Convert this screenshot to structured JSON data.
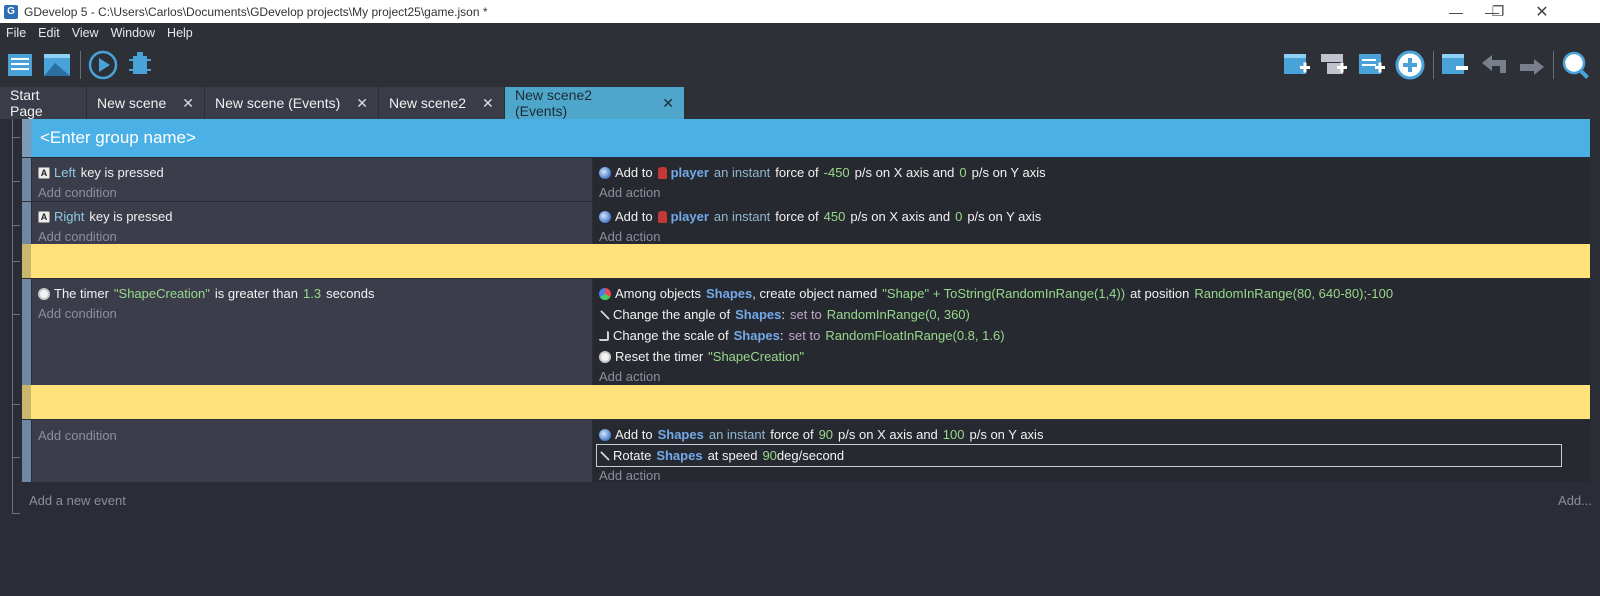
{
  "window": {
    "title": "GDevelop 5 - C:\\Users\\Carlos\\Documents\\GDevelop projects\\My project25\\game.json *",
    "app_icon_glyph": "G",
    "controls": {
      "minimize": "—",
      "maximize": "❐",
      "close": "✕"
    }
  },
  "menu": [
    "File",
    "Edit",
    "View",
    "Window",
    "Help"
  ],
  "toolbar": {
    "left_icons": [
      "project-manager-icon",
      "scene-editor-icon",
      "preview-icon",
      "debug-icon"
    ],
    "right_icons": [
      "add-event-icon",
      "add-sub-event-icon",
      "add-comment-icon",
      "add-more-icon",
      "delete-icon",
      "undo-icon",
      "redo-icon",
      "search-icon"
    ]
  },
  "tabs": [
    {
      "label": "Start Page",
      "closable": false,
      "active": false
    },
    {
      "label": "New scene",
      "closable": true,
      "active": false
    },
    {
      "label": "New scene (Events)",
      "closable": true,
      "active": false
    },
    {
      "label": "New scene2",
      "closable": true,
      "active": false
    },
    {
      "label": "New scene2 (Events)",
      "closable": true,
      "active": true
    }
  ],
  "tab_close_glyph": "✕",
  "events": {
    "group_name_placeholder": "<Enter group name>",
    "add_condition": "Add condition",
    "add_action": "Add action",
    "add_new_event": "Add a new event",
    "add_right": "Add...",
    "event1": {
      "condition": {
        "key": "Left",
        "text": "key is pressed"
      },
      "action": {
        "pre": "Add to",
        "object": "player",
        "mid": "an instant",
        "force": "force of",
        "x": "-450",
        "axis_x": "p/s on X axis and",
        "y": "0",
        "axis_y": "p/s on Y axis"
      }
    },
    "event2": {
      "condition": {
        "key": "Right",
        "text": "key is pressed"
      },
      "action": {
        "pre": "Add to",
        "object": "player",
        "mid": "an instant",
        "force": "force of",
        "x": "450",
        "axis_x": "p/s on X axis and",
        "y": "0",
        "axis_y": "p/s on Y axis"
      }
    },
    "event3": {
      "condition": {
        "pre": "The timer",
        "timer": "\"ShapeCreation\"",
        "mid": "is greater than",
        "value": "1.3",
        "unit": "seconds"
      },
      "actions": {
        "create": {
          "pre": "Among objects",
          "object": "Shapes",
          "mid": ", create object named",
          "name_expr": "\"Shape\" + ToString(RandomInRange(1,4))",
          "at": "at position",
          "pos": "RandomInRange(80, 640-80);-100"
        },
        "angle": {
          "pre": "Change the angle of",
          "object": "Shapes",
          "colon": ":",
          "set": "set to",
          "value": "RandomInRange(0, 360)"
        },
        "scale": {
          "pre": "Change the scale of",
          "object": "Shapes",
          "colon": ":",
          "set": "set to",
          "value": "RandomFloatInRange(0.8, 1.6)"
        },
        "reset": {
          "pre": "Reset the timer",
          "timer": "\"ShapeCreation\""
        }
      }
    },
    "event4": {
      "actions": {
        "force": {
          "pre": "Add to",
          "object": "Shapes",
          "mid": "an instant",
          "force": "force of",
          "x": "90",
          "axis_x": "p/s on X axis and",
          "y": "100",
          "axis_y": "p/s on Y axis"
        },
        "rotate": {
          "pre": "Rotate",
          "object": "Shapes",
          "mid": "at speed",
          "value": "90",
          "unit": "deg/second"
        }
      }
    }
  },
  "colors": {
    "group": "#4ab0e6",
    "comment": "#ffe27a",
    "active_tab": "#4ea6cb",
    "object": "#72a9e8",
    "number": "#98d78b"
  }
}
